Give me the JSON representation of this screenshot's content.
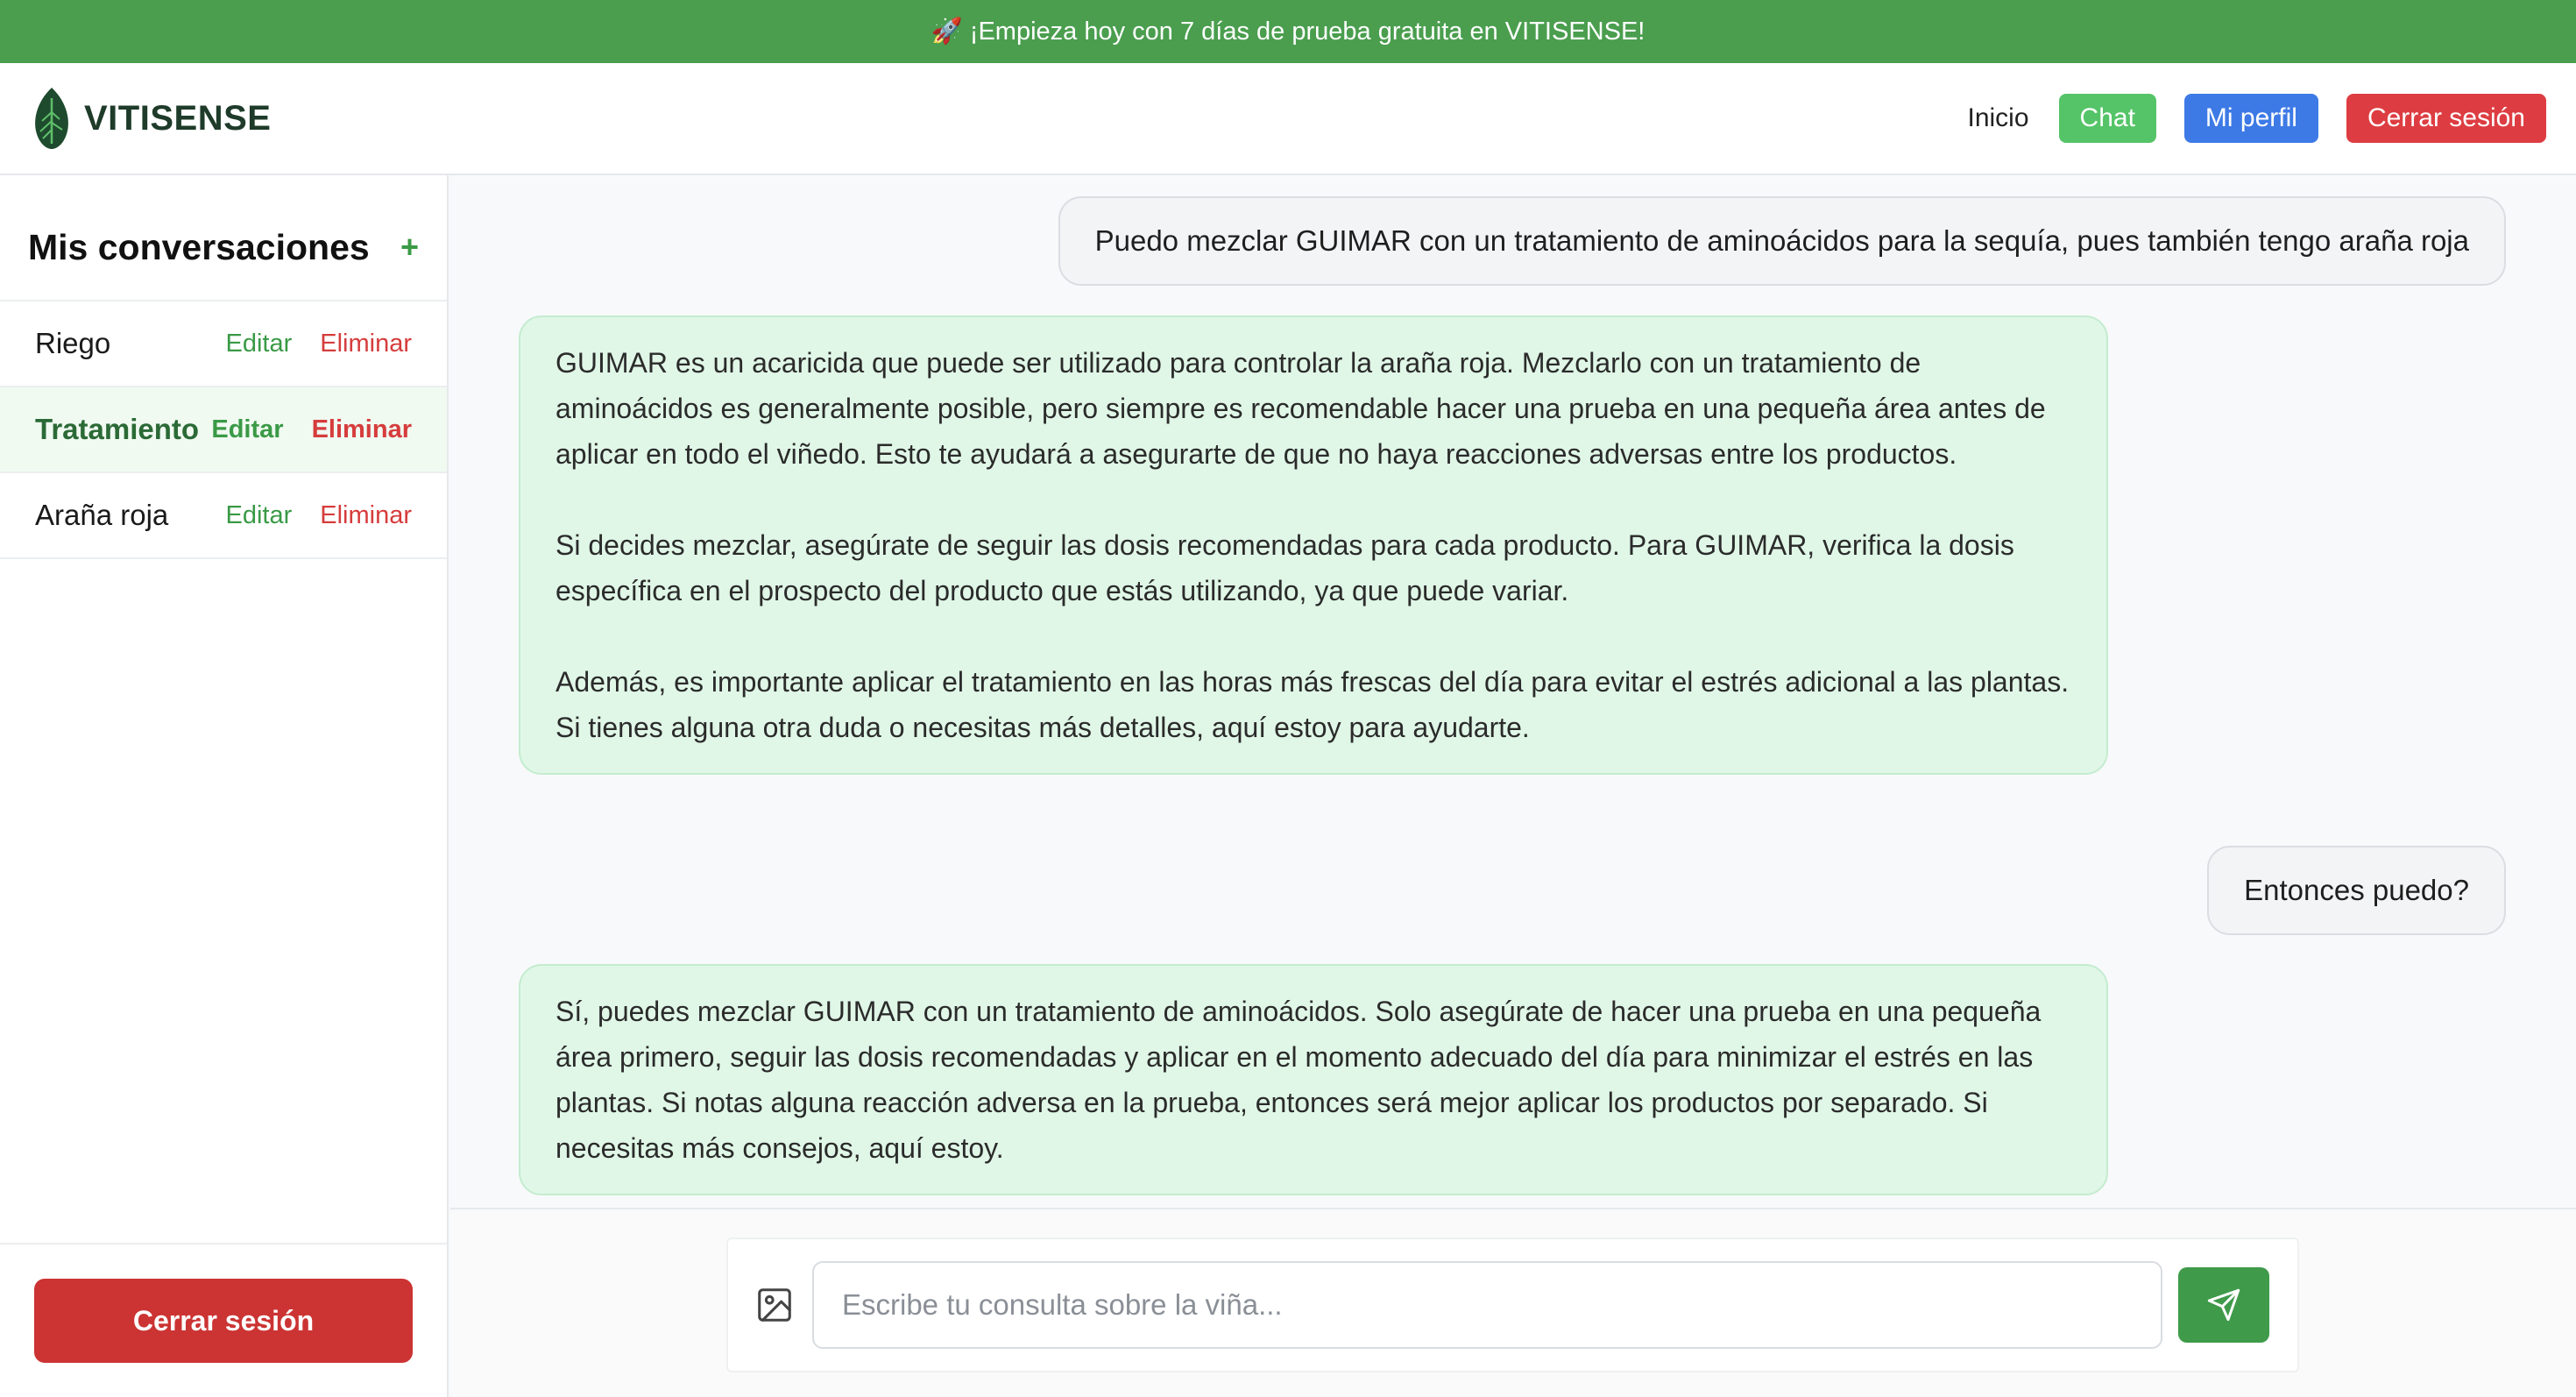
{
  "promo": {
    "icon": "rocket-icon",
    "text": "🚀 ¡Empieza hoy con 7 días de prueba gratuita en VITISENSE!"
  },
  "brand": {
    "name": "VITISENSE",
    "logo_icon": "leaf-icon"
  },
  "nav": {
    "home": "Inicio",
    "chat": "Chat",
    "profile": "Mi perfil",
    "logout": "Cerrar sesión"
  },
  "sidebar": {
    "title": "Mis conversaciones",
    "new_label": "+",
    "edit_label": "Editar",
    "delete_label": "Eliminar",
    "conversations": [
      {
        "name": "Riego",
        "active": false
      },
      {
        "name": "Tratamiento",
        "active": true
      },
      {
        "name": "Araña roja",
        "active": false
      }
    ],
    "logout": "Cerrar sesión"
  },
  "messages": [
    {
      "role": "user",
      "text": "Puedo mezclar GUIMAR con un tratamiento de aminoácidos para la sequía, pues también tengo araña roja"
    },
    {
      "role": "assistant",
      "paragraphs": [
        "GUIMAR es un acaricida que puede ser utilizado para controlar la araña roja. Mezclarlo con un tratamiento de aminoácidos es generalmente posible, pero siempre es recomendable hacer una prueba en una pequeña área antes de aplicar en todo el viñedo. Esto te ayudará a asegurarte de que no haya reacciones adversas entre los productos.",
        "Si decides mezclar, asegúrate de seguir las dosis recomendadas para cada producto. Para GUIMAR, verifica la dosis específica en el prospecto del producto que estás utilizando, ya que puede variar.",
        "Además, es importante aplicar el tratamiento en las horas más frescas del día para evitar el estrés adicional a las plantas. Si tienes alguna otra duda o necesitas más detalles, aquí estoy para ayudarte."
      ]
    },
    {
      "role": "user",
      "text": "Entonces puedo?"
    },
    {
      "role": "assistant",
      "paragraphs": [
        "Sí, puedes mezclar GUIMAR con un tratamiento de aminoácidos. Solo asegúrate de hacer una prueba en una pequeña área primero, seguir las dosis recomendadas y aplicar en el momento adecuado del día para minimizar el estrés en las plantas. Si notas alguna reacción adversa en la prueba, entonces será mejor aplicar los productos por separado. Si necesitas más consejos, aquí estoy."
      ]
    }
  ],
  "composer": {
    "placeholder": "Escribe tu consulta sobre la viña...",
    "value": "",
    "attach_icon": "image-icon",
    "send_icon": "send-icon"
  },
  "colors": {
    "primary_green": "#4a9e4e",
    "chat_button": "#55c468",
    "profile_button": "#3d7ae6",
    "logout_button": "#dd3d42",
    "assistant_bubble": "#e0f7e7"
  }
}
